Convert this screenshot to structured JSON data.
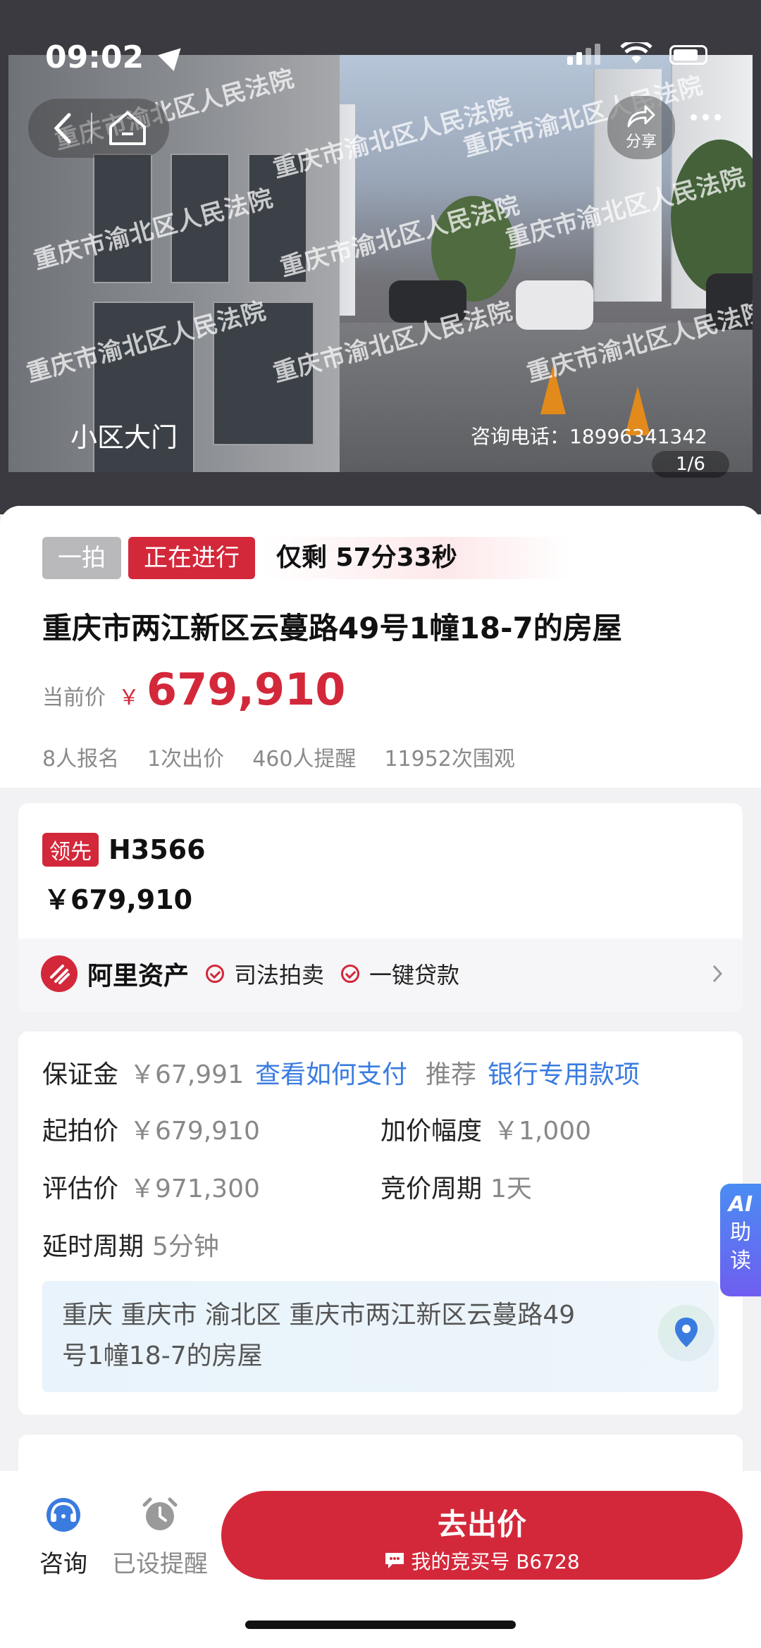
{
  "status_bar": {
    "time": "09:02"
  },
  "photo": {
    "caption": "小区大门",
    "phone": "咨询电话：18996341342",
    "counter": "1/6",
    "share_label": "分享",
    "watermark": "重庆市渝北区人民法院"
  },
  "auction": {
    "round_tag": "一拍",
    "status_tag": "正在进行",
    "countdown": "仅剩 57分33秒",
    "title": "重庆市两江新区云蔓路49号1幢18-7的房屋",
    "price_label": "当前价",
    "currency": "￥",
    "current_price": "679,910",
    "stats": [
      "8人报名",
      "1次出价",
      "460人提醒",
      "11952次围观"
    ]
  },
  "lead_bid": {
    "badge": "领先",
    "bidder": "H3566",
    "amount": "￥679,910"
  },
  "provider": {
    "brand": "阿里资产",
    "features": [
      "司法拍卖",
      "一键贷款"
    ]
  },
  "details": {
    "deposit_label": "保证金",
    "deposit_value": "￥67,991",
    "deposit_link": "查看如何支付",
    "recommend_label": "推荐",
    "recommend_link": "银行专用款项",
    "start_label": "起拍价",
    "start_value": "￥679,910",
    "increment_label": "加价幅度",
    "increment_value": "￥1,000",
    "appraise_label": "评估价",
    "appraise_value": "￥971,300",
    "cycle_label": "竞价周期",
    "cycle_value": "1天",
    "delay_label": "延时周期",
    "delay_value": "5分钟",
    "address_line1": "重庆 重庆市 渝北区 重庆市两江新区云蔓路49",
    "address_line2": "号1幢18-7的房屋"
  },
  "ai_tab": {
    "line1": "AI",
    "line2": "助",
    "line3": "读"
  },
  "bottom_bar": {
    "consult_label": "咨询",
    "reminder_label": "已设提醒",
    "bid_button": "去出价",
    "bid_number": "我的竞买号 B6728"
  },
  "colors": {
    "accent": "#d3283a",
    "link": "#3a7be0"
  }
}
